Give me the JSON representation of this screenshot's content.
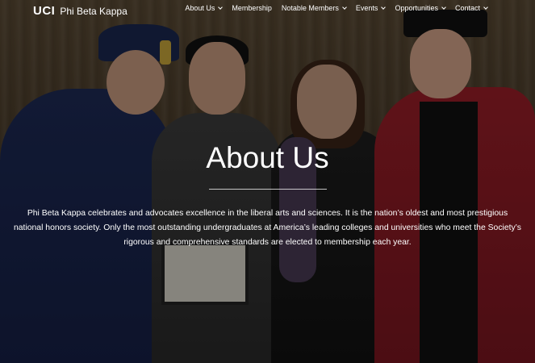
{
  "header": {
    "logo_text": "UCI",
    "site_name": "Phi Beta Kappa"
  },
  "nav": {
    "items": [
      {
        "label": "About Us",
        "dropdown": true
      },
      {
        "label": "Membership",
        "dropdown": false
      },
      {
        "label": "Notable Members",
        "dropdown": true
      },
      {
        "label": "Events",
        "dropdown": true
      },
      {
        "label": "Opportunities",
        "dropdown": true
      },
      {
        "label": "Contact",
        "dropdown": true
      }
    ]
  },
  "hero": {
    "title": "About Us",
    "description": "Phi Beta Kappa celebrates and advocates excellence in the liberal arts and sciences. It is the nation’s oldest and most prestigious national honors society. Only the most outstanding undergraduates at America’s leading colleges and universities who meet the Society’s rigorous and comprehensive standards are elected to membership each year."
  },
  "icons": {
    "dropdown": "chevron-down-icon"
  }
}
